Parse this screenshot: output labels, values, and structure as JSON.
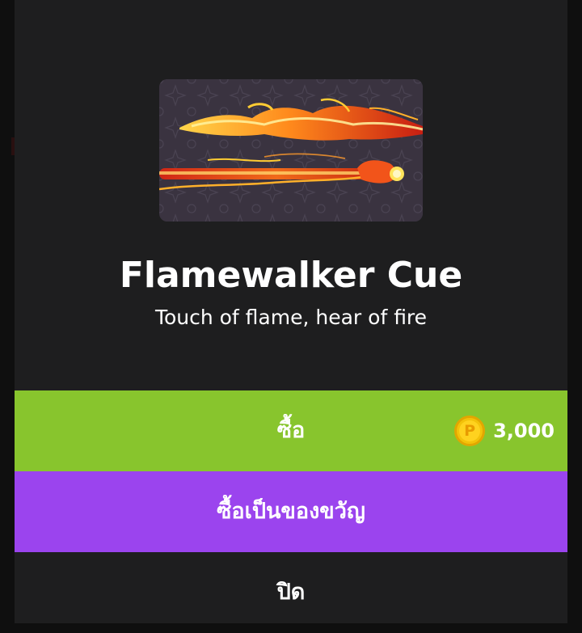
{
  "item": {
    "name": "Flamewalker Cue",
    "description": "Touch of flame, hear of fire",
    "image_icon": "flame-cue-image"
  },
  "actions": {
    "buy_label": "ซื้อ",
    "gift_label": "ซื้อเป็นของขวัญ",
    "close_label": "ปิด"
  },
  "price": {
    "currency_symbol": "P",
    "currency_icon": "coin-icon",
    "amount": "3,000"
  },
  "colors": {
    "dialog_bg": "#1e1e1f",
    "buy_button": "#88c52d",
    "gift_button": "#9b44ee",
    "coin": "#f3c20a"
  }
}
